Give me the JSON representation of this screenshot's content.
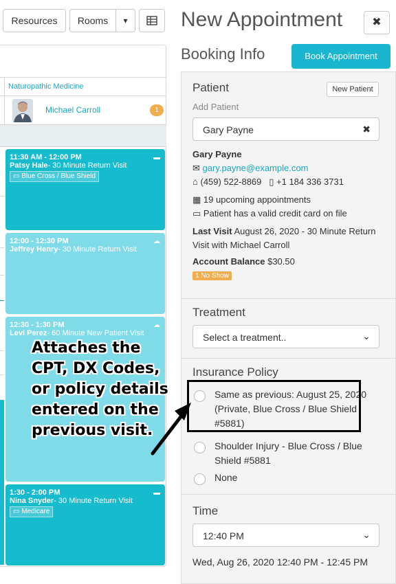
{
  "toolbar": {
    "resources_label": "Resources",
    "rooms_label": "Rooms",
    "dropdown_glyph": "▾",
    "grid_glyph": "▦"
  },
  "calendar": {
    "column_header": "Naturopathic Medicine",
    "provider_name": "Michael Carroll",
    "provider_badge": "1",
    "appointments": [
      {
        "time": "11:30 AM - 12:00 PM",
        "patient": "Patsy Hale",
        "type": "- 30 Minute Return Visit",
        "insurance": "Blue Cross / Blue Shield",
        "style": "dark",
        "corner": "card-icon"
      },
      {
        "time": "12:00 - 12:30 PM",
        "patient": "Jeffrey Henry",
        "type": "- 30 Minute Return Visit",
        "insurance": "",
        "style": "light",
        "corner": "cloud-icon"
      },
      {
        "time": "12:30 - 1:30 PM",
        "patient": "Levi Perez",
        "type": "- 60 Minute New Patient Visit",
        "insurance": "",
        "style": "light",
        "corner": "cloud-icon"
      },
      {
        "time": "1:30 - 2:00 PM",
        "patient": "Nina Snyder",
        "type": "- 30 Minute Return Visit",
        "insurance": "Medicare",
        "style": "dark",
        "corner": "card-icon"
      }
    ]
  },
  "callout": {
    "text": "Attaches the CPT, DX Codes, or policy details entered on the previous visit."
  },
  "panel": {
    "title": "New Appointment",
    "close_glyph": "✖",
    "booking_label": "Booking Info",
    "book_button": "Book Appointment"
  },
  "patient": {
    "section_title": "Patient",
    "new_patient_button": "New Patient",
    "add_patient_label": "Add Patient",
    "selected_value": "Gary Payne",
    "clear_glyph": "✖",
    "name": "Gary Payne",
    "email": "gary.payne@example.com",
    "phone": "(459) 522-8869",
    "phone2": "+1 184 336 3731",
    "upcoming": "19 upcoming appointments",
    "card_on_file": "Patient has a valid credit card on file",
    "last_visit_label": "Last Visit",
    "last_visit_value": " August 26, 2020 - 30 Minute Return Visit with Michael Carroll",
    "balance_label": "Account Balance",
    "balance_value": " $30.50",
    "no_show_badge": "1 No Show"
  },
  "treatment": {
    "section_title": "Treatment",
    "placeholder": "Select a treatment.."
  },
  "insurance": {
    "section_title": "Insurance Policy",
    "options": [
      "Same as previous: August 25, 2020 (Private, Blue Cross / Blue Shield #5881)",
      "Shoulder Injury - Blue Cross / Blue Shield #5881",
      "None"
    ]
  },
  "time": {
    "section_title": "Time",
    "selected": "12:40 PM",
    "range_text": "Wed, Aug 26, 2020 12:40 PM - 12:45 PM"
  },
  "colors": {
    "accent": "#1ab6cf",
    "appointment_dark": "#16bccd",
    "appointment_light": "#7fdbe8",
    "badge_orange": "#f0ad4e"
  }
}
